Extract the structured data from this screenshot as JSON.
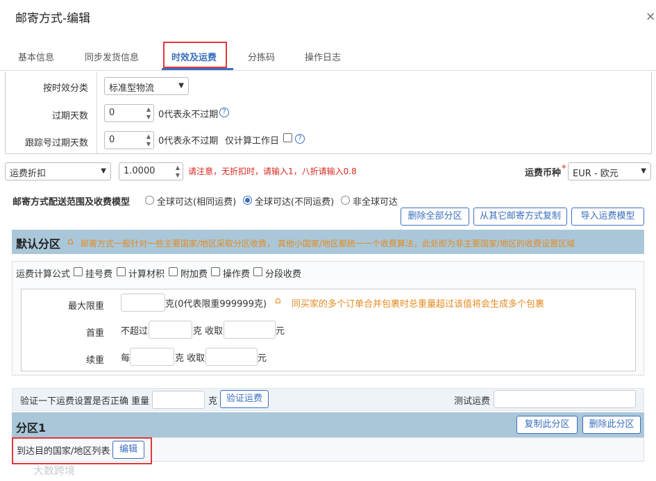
{
  "dialog": {
    "title": "邮寄方式-编辑",
    "close_icon": "×"
  },
  "tabs": [
    {
      "label": "基本信息"
    },
    {
      "label": "同步发货信息"
    },
    {
      "label": "时效及运费"
    },
    {
      "label": "分拣码"
    },
    {
      "label": "操作日志"
    }
  ],
  "timeliness": {
    "category_label": "按时效分类",
    "category_value": "标准型物流",
    "expire_days_label": "过期天数",
    "expire_days_value": "0",
    "expire_days_hint": "0代表永不过期",
    "tracking_expire_label": "跟踪号过期天数",
    "tracking_expire_value": "0",
    "tracking_expire_hint": "0代表永不过期",
    "workday_label": "仅计算工作日"
  },
  "discount": {
    "type_value": "运费折扣",
    "value": "1.0000",
    "notice": "请注意，无折扣时，请输入1，八折请输入0.8",
    "currency_label": "运费币种",
    "currency_required": "*",
    "currency_value": "EUR - 欧元"
  },
  "scope": {
    "label": "邮寄方式配送范围及收费模型",
    "options": [
      "全球可达(相同运费)",
      "全球可达(不同运费)",
      "非全球可达"
    ],
    "selected_index": 1,
    "buttons": [
      "删除全部分区",
      "从其它邮寄方式复制",
      "导入运费模型"
    ]
  },
  "default_zone": {
    "title": "默认分区",
    "tip": "邮寄方式一般针对一些主要国家/地区采取分区收费， 其他小国家/地区都统一一个收费算法，此处即为非主要国家/地区的收费设置区域",
    "formula_label": "运费计算公式",
    "formula_options": [
      "挂号费",
      "计算材积",
      "附加费",
      "操作费",
      "分段收费"
    ],
    "max_weight_label": "最大限重",
    "max_weight_unit": "克(0代表限重999999克)",
    "max_weight_tip": "同买家的多个订单合并包裹时总重量超过该值将会生成多个包裹",
    "first_weight_label": "首重",
    "first_weight_prefix": "不超过",
    "first_weight_mid": "克 收取",
    "first_weight_suffix": "元",
    "add_weight_label": "续重",
    "add_weight_prefix": "每",
    "add_weight_mid": "克 收取",
    "add_weight_suffix": "元"
  },
  "verify": {
    "label": "验证一下运费设置是否正确 重量",
    "unit": "克",
    "button": "验证运费",
    "test_label": "测试运费"
  },
  "zone1": {
    "title": "分区1",
    "copy_button": "复制此分区",
    "delete_button": "删除此分区",
    "countries_label": "到达目的国家/地区列表",
    "edit_button": "编辑"
  },
  "watermark": "大数跨境",
  "colors": {
    "accent": "#3a6fbd",
    "highlight": "#e0373b",
    "warning": "#d9281f",
    "tip": "#e58a1f",
    "zone_header": "#a9c7d9"
  }
}
